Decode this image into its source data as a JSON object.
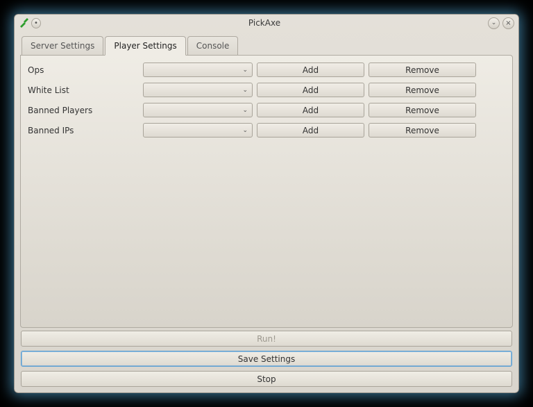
{
  "window": {
    "title": "PickAxe"
  },
  "tabs": {
    "server": "Server Settings",
    "player": "Player Settings",
    "console": "Console",
    "active": "player"
  },
  "rows": [
    {
      "label": "Ops",
      "add": "Add",
      "remove": "Remove"
    },
    {
      "label": "White List",
      "add": "Add",
      "remove": "Remove"
    },
    {
      "label": "Banned Players",
      "add": "Add",
      "remove": "Remove"
    },
    {
      "label": "Banned IPs",
      "add": "Add",
      "remove": "Remove"
    }
  ],
  "buttons": {
    "run": "Run!",
    "save": "Save Settings",
    "stop": "Stop"
  }
}
